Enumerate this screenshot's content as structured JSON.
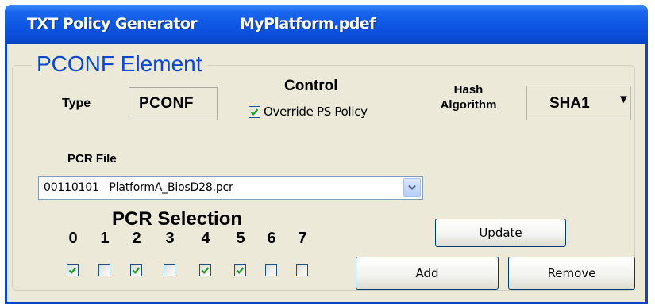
{
  "window": {
    "title_app": "TXT Policy Generator",
    "title_file": "MyPlatform.pdef"
  },
  "group": {
    "title": "PCONF Element"
  },
  "type": {
    "label": "Type",
    "value": "PCONF"
  },
  "control": {
    "label": "Control",
    "override_label": "Override PS Policy",
    "override_checked": true
  },
  "hash": {
    "label_line1": "Hash",
    "label_line2": "Algorithm",
    "selected": "SHA1"
  },
  "pcr_file": {
    "label": "PCR File",
    "selected": "00110101   PlatformA_BiosD28.pcr"
  },
  "pcr_selection": {
    "label": "PCR Selection",
    "items": [
      {
        "num": "0",
        "checked": true
      },
      {
        "num": "1",
        "checked": false
      },
      {
        "num": "2",
        "checked": true
      },
      {
        "num": "3",
        "checked": false
      },
      {
        "num": "4",
        "checked": true
      },
      {
        "num": "5",
        "checked": true
      },
      {
        "num": "6",
        "checked": false
      },
      {
        "num": "7",
        "checked": false
      }
    ]
  },
  "buttons": {
    "update": "Update",
    "add": "Add",
    "remove": "Remove"
  },
  "colors": {
    "titlebar": "#0a4cd6",
    "group_title": "#0a46d2",
    "window_bg": "#ece9d8",
    "checkmark": "#21a121"
  }
}
